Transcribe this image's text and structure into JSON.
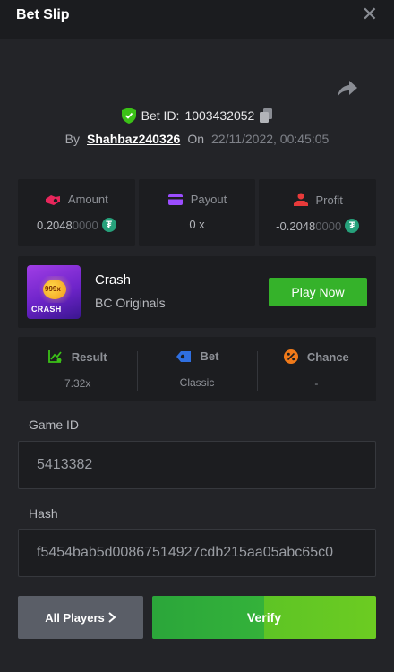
{
  "header": {
    "title": "Bet Slip",
    "close_icon": "close-icon"
  },
  "bet": {
    "id_label": "Bet ID:",
    "id": "1003432052",
    "by_label": "By",
    "username": "Shahbaz240326",
    "on_label": "On",
    "datetime": "22/11/2022, 00:45:05"
  },
  "stats": {
    "amount": {
      "label": "Amount",
      "value_main": "0.2048",
      "value_dim": "0000",
      "currency_icon": "tether-icon"
    },
    "payout": {
      "label": "Payout",
      "value": "0 x"
    },
    "profit": {
      "label": "Profit",
      "value_main": "-0.2048",
      "value_dim": "0000",
      "currency_icon": "tether-icon"
    }
  },
  "game": {
    "thumb_multiplier": "999x",
    "thumb_title": "CRASH",
    "name": "Crash",
    "provider": "BC Originals",
    "play_label": "Play Now"
  },
  "result": {
    "result_label": "Result",
    "result_value": "7.32x",
    "bet_label": "Bet",
    "bet_value": "Classic",
    "chance_label": "Chance",
    "chance_value": "-"
  },
  "fields": {
    "game_id_label": "Game ID",
    "game_id_value": "5413382",
    "hash_label": "Hash",
    "hash_value": "f5454bab5d00867514927cdb215aa05abc65c0"
  },
  "actions": {
    "players_label": "All Players",
    "verify_label": "Verify"
  },
  "colors": {
    "background": "#232428",
    "panel": "#1c1d20",
    "accent_green": "#35b22a",
    "amount_icon": "#e8265b",
    "payout_icon": "#9b4dff",
    "profit_icon": "#e83a3a",
    "verified_shield": "#3bc117",
    "tether": "#26a17b"
  }
}
